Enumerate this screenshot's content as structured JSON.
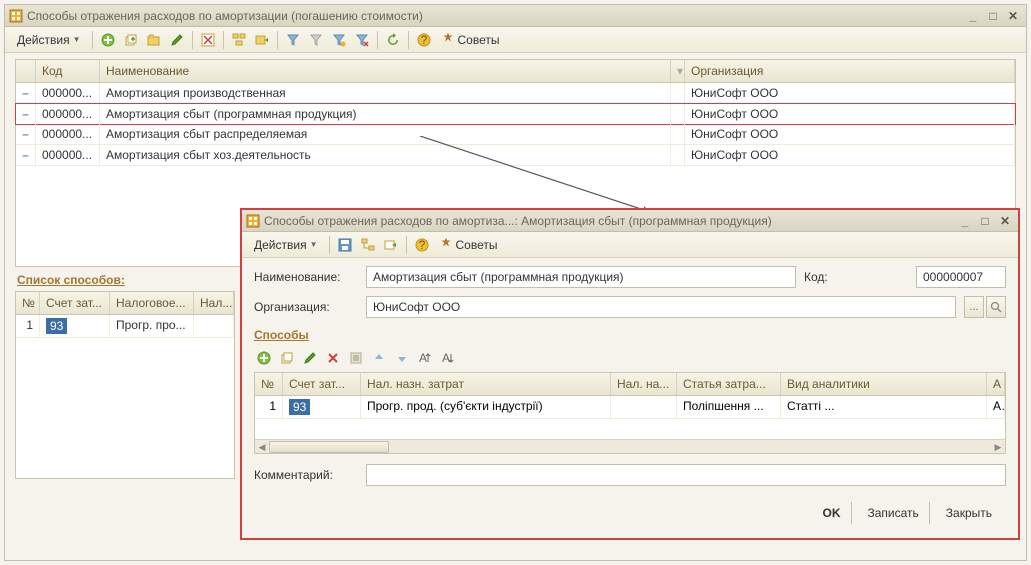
{
  "mainWindow": {
    "title": "Способы отражения расходов по амортизации (погашению стоимости)",
    "actionsLabel": "Действия",
    "tipsLabel": "Советы",
    "columns": {
      "code": "Код",
      "name": "Наименование",
      "org": "Организация"
    },
    "rows": [
      {
        "code": "000000...",
        "name": "Амортизация производственная",
        "org": "ЮниСофт ООО"
      },
      {
        "code": "000000...",
        "name": "Амортизация сбыт (программная продукция)",
        "org": "ЮниСофт ООО"
      },
      {
        "code": "000000...",
        "name": "Амортизация сбыт распределяемая",
        "org": "ЮниСофт ООО"
      },
      {
        "code": "000000...",
        "name": "Амортизация сбыт хоз.деятельность",
        "org": "ЮниСофт ООО"
      }
    ],
    "listTitle": "Список способов:",
    "smallGrid": {
      "cols": {
        "n": "№",
        "acc": "Счет зат...",
        "tax": "Налоговое...",
        "last": "Нал..."
      },
      "row": {
        "n": "1",
        "acc": "93",
        "tax": "Прогр. про..."
      }
    }
  },
  "dialog": {
    "title": "Способы отражения расходов по амортиза...: Амортизация сбыт (программная продукция)",
    "actionsLabel": "Действия",
    "tipsLabel": "Советы",
    "fields": {
      "nameLabel": "Наименование:",
      "nameValue": "Амортизация сбыт (программная продукция)",
      "codeLabel": "Код:",
      "codeValue": "000000007",
      "orgLabel": "Организация:",
      "orgValue": "ЮниСофт ООО",
      "commentLabel": "Комментарий:",
      "commentValue": ""
    },
    "subTitle": "Способы",
    "dgrid": {
      "cols": {
        "n": "№",
        "acc": "Счет зат...",
        "tax": "Нал. назн. затрат",
        "nn": "Нал. на...",
        "art": "Статья затра...",
        "an": "Вид аналитики",
        "last": "А"
      },
      "row": {
        "n": "1",
        "acc": "93",
        "tax": "Прогр. прод. (суб'єкти індустрії)",
        "nn": "",
        "art": "Поліпшення ...",
        "an": "Статті ...",
        "last": "А"
      }
    },
    "buttons": {
      "ok": "OK",
      "save": "Записать",
      "close": "Закрыть"
    }
  }
}
